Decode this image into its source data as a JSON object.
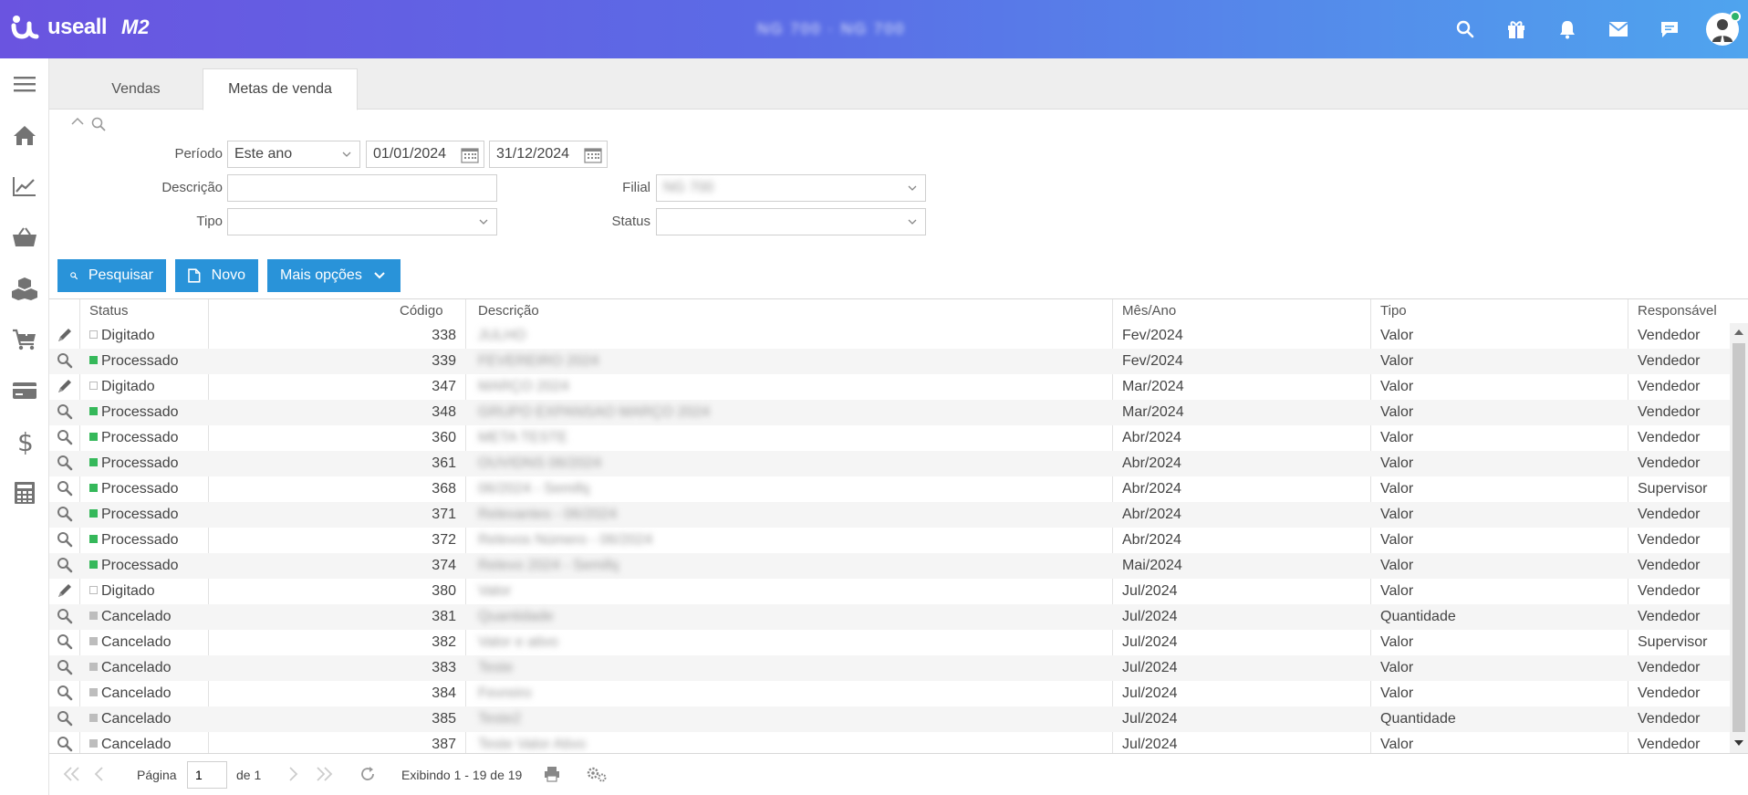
{
  "app": {
    "brand": "useall",
    "version": "M2",
    "window_title": "NG 700 · NG 700"
  },
  "tabs": [
    {
      "label": "Vendas",
      "active": false
    },
    {
      "label": "Metas de venda",
      "active": true
    }
  ],
  "filter": {
    "periodo_label": "Período",
    "periodo_value": "Este ano",
    "date_start": "01/01/2024",
    "date_end": "31/12/2024",
    "descricao_label": "Descrição",
    "descricao_value": "",
    "filial_label": "Filial",
    "filial_value": "NG 700",
    "tipo_label": "Tipo",
    "tipo_value": "",
    "status_label": "Status",
    "status_value": ""
  },
  "actions": {
    "search_label": "Pesquisar",
    "new_label": "Novo",
    "more_label": "Mais opções"
  },
  "grid": {
    "columns": {
      "status": "Status",
      "codigo": "Código",
      "descricao": "Descrição",
      "mes_ano": "Mês/Ano",
      "tipo": "Tipo",
      "responsavel": "Responsável"
    },
    "rows": [
      {
        "action": "edit",
        "status": "Digitado",
        "status_kind": "dig",
        "codigo": "338",
        "descricao": "JULHO",
        "mes_ano": "Fev/2024",
        "tipo": "Valor",
        "responsavel": "Vendedor"
      },
      {
        "action": "search",
        "status": "Processado",
        "status_kind": "proc",
        "codigo": "339",
        "descricao": "FEVEREIRO 2024",
        "mes_ano": "Fev/2024",
        "tipo": "Valor",
        "responsavel": "Vendedor"
      },
      {
        "action": "edit",
        "status": "Digitado",
        "status_kind": "dig",
        "codigo": "347",
        "descricao": "MARÇO 2024",
        "mes_ano": "Mar/2024",
        "tipo": "Valor",
        "responsavel": "Vendedor"
      },
      {
        "action": "search",
        "status": "Processado",
        "status_kind": "proc",
        "codigo": "348",
        "descricao": "GRUPO EXPANSAO MARÇO 2024",
        "mes_ano": "Mar/2024",
        "tipo": "Valor",
        "responsavel": "Vendedor"
      },
      {
        "action": "search",
        "status": "Processado",
        "status_kind": "proc",
        "codigo": "360",
        "descricao": "META TESTE",
        "mes_ano": "Abr/2024",
        "tipo": "Valor",
        "responsavel": "Vendedor"
      },
      {
        "action": "search",
        "status": "Processado",
        "status_kind": "proc",
        "codigo": "361",
        "descricao": "OUVIDNS 06/2024",
        "mes_ano": "Abr/2024",
        "tipo": "Valor",
        "responsavel": "Vendedor"
      },
      {
        "action": "search",
        "status": "Processado",
        "status_kind": "proc",
        "codigo": "368",
        "descricao": "06/2024 - Semifq",
        "mes_ano": "Abr/2024",
        "tipo": "Valor",
        "responsavel": "Supervisor"
      },
      {
        "action": "search",
        "status": "Processado",
        "status_kind": "proc",
        "codigo": "371",
        "descricao": "Relevantes - 06/2024",
        "mes_ano": "Abr/2024",
        "tipo": "Valor",
        "responsavel": "Vendedor"
      },
      {
        "action": "search",
        "status": "Processado",
        "status_kind": "proc",
        "codigo": "372",
        "descricao": "Relevos Número - 06/2024",
        "mes_ano": "Abr/2024",
        "tipo": "Valor",
        "responsavel": "Vendedor"
      },
      {
        "action": "search",
        "status": "Processado",
        "status_kind": "proc",
        "codigo": "374",
        "descricao": "Relevo 2024 - Semifq",
        "mes_ano": "Mai/2024",
        "tipo": "Valor",
        "responsavel": "Vendedor"
      },
      {
        "action": "edit",
        "status": "Digitado",
        "status_kind": "dig",
        "codigo": "380",
        "descricao": "Valor",
        "mes_ano": "Jul/2024",
        "tipo": "Valor",
        "responsavel": "Vendedor"
      },
      {
        "action": "search",
        "status": "Cancelado",
        "status_kind": "canc",
        "codigo": "381",
        "descricao": "Quantidade",
        "mes_ano": "Jul/2024",
        "tipo": "Quantidade",
        "responsavel": "Vendedor"
      },
      {
        "action": "search",
        "status": "Cancelado",
        "status_kind": "canc",
        "codigo": "382",
        "descricao": "Valor e ativo",
        "mes_ano": "Jul/2024",
        "tipo": "Valor",
        "responsavel": "Supervisor"
      },
      {
        "action": "search",
        "status": "Cancelado",
        "status_kind": "canc",
        "codigo": "383",
        "descricao": "Teste",
        "mes_ano": "Jul/2024",
        "tipo": "Valor",
        "responsavel": "Vendedor"
      },
      {
        "action": "search",
        "status": "Cancelado",
        "status_kind": "canc",
        "codigo": "384",
        "descricao": "Fevreiro",
        "mes_ano": "Jul/2024",
        "tipo": "Valor",
        "responsavel": "Vendedor"
      },
      {
        "action": "search",
        "status": "Cancelado",
        "status_kind": "canc",
        "codigo": "385",
        "descricao": "Teste2",
        "mes_ano": "Jul/2024",
        "tipo": "Quantidade",
        "responsavel": "Vendedor"
      },
      {
        "action": "search",
        "status": "Cancelado",
        "status_kind": "canc",
        "codigo": "387",
        "descricao": "Teste Valor Ativo",
        "mes_ano": "Jul/2024",
        "tipo": "Valor",
        "responsavel": "Vendedor"
      }
    ]
  },
  "pager": {
    "page_label": "Página",
    "page_value": "1",
    "of_label": "de 1",
    "display_text": "Exibindo 1 - 19 de 19"
  },
  "colors": {
    "primary": "#2993d9",
    "processado": "#35b85a",
    "cancelado": "#bdbdbd",
    "topbar_start": "#6a54e0",
    "topbar_end": "#4fa4ee"
  }
}
